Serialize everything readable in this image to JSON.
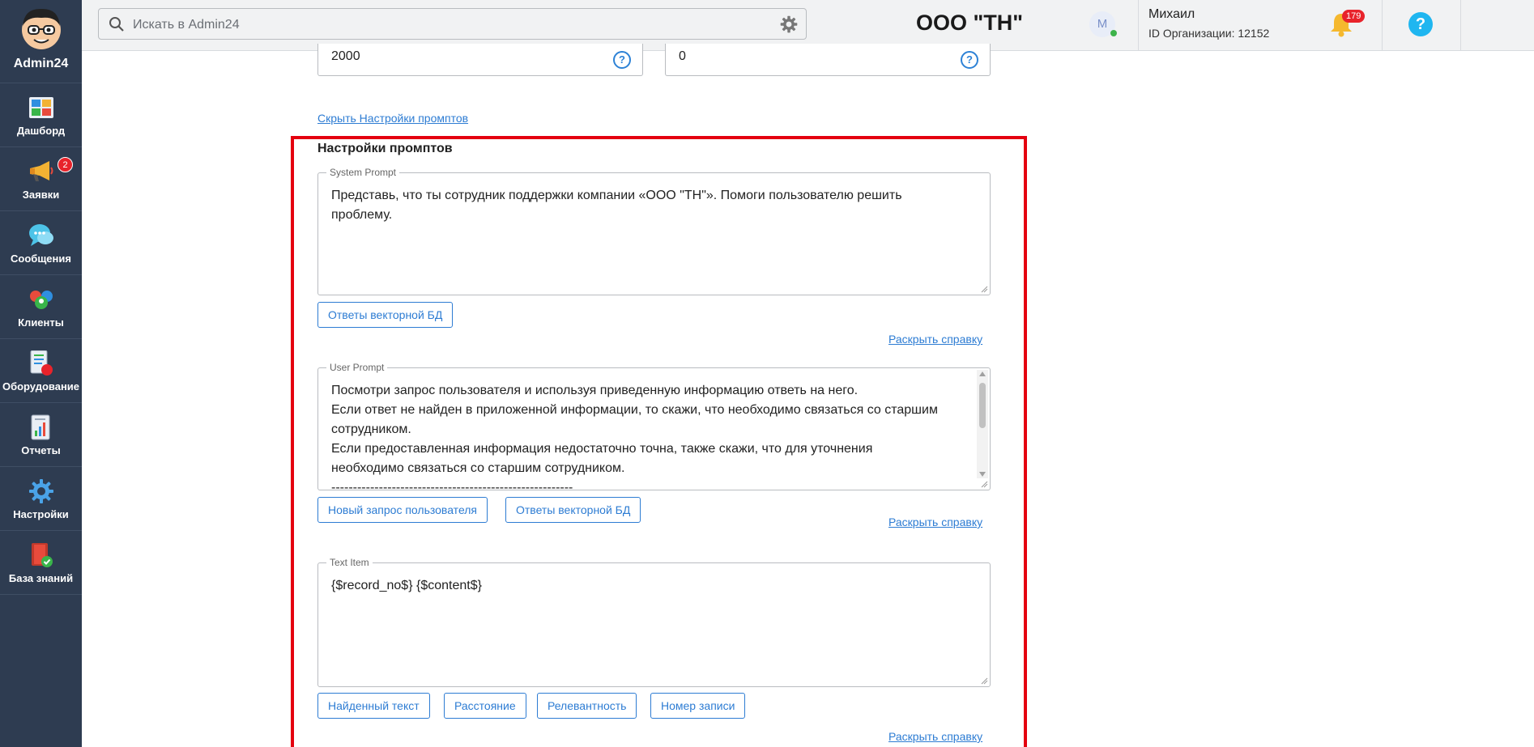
{
  "sidebar": {
    "brand": "Admin24",
    "items": [
      {
        "label": "Дашборд",
        "icon": "dashboard-icon"
      },
      {
        "label": "Заявки",
        "icon": "megaphone-icon",
        "badge": "2"
      },
      {
        "label": "Сообщения",
        "icon": "chat-icon"
      },
      {
        "label": "Клиенты",
        "icon": "clients-icon"
      },
      {
        "label": "Оборудование",
        "icon": "equipment-icon"
      },
      {
        "label": "Отчеты",
        "icon": "report-icon"
      },
      {
        "label": "Настройки",
        "icon": "gear-icon"
      },
      {
        "label": "База знаний",
        "icon": "knowledge-base-icon"
      }
    ]
  },
  "header": {
    "search_placeholder": "Искать в Admin24",
    "company": "ООО \"ТН\"",
    "user_initial": "М",
    "user_name": "Михаил",
    "org_id": "ID Организации: 12152",
    "notifications": "179",
    "help": "?"
  },
  "top_fields": {
    "left_value": "2000",
    "right_value": "0"
  },
  "hide_link": "Скрыть Настройки промптов",
  "prompts": {
    "title": "Настройки промптов",
    "system": {
      "legend": "System Prompt",
      "text": "Представь, что ты сотрудник поддержки компании «ООО \"ТН\"». Помоги пользователю решить\nпроблему.",
      "buttons": [
        "Ответы векторной БД"
      ],
      "help_link": "Раскрыть справку"
    },
    "user": {
      "legend": "User Prompt",
      "text": "Посмотри запрос пользователя и используя приведенную информацию ответь на него.\nЕсли ответ не найден в приложенной информации, то скажи, что необходимо связаться со старшим\nсотрудником.\nЕсли предоставленная информация недостаточно точна, также скажи, что для уточнения\nнеобходимо связаться со старшим сотрудником.\n--------------------------------------------------------",
      "buttons": [
        "Новый запрос пользователя",
        "Ответы векторной БД"
      ],
      "help_link": "Раскрыть справку"
    },
    "text_item": {
      "legend": "Text Item",
      "text": "{$record_no$} {$content$}",
      "buttons": [
        "Найденный текст",
        "Расстояние",
        "Релевантность",
        "Номер записи"
      ],
      "help_link": "Раскрыть справку"
    }
  },
  "colors": {
    "sidebar": "#2e3c51",
    "link": "#2d7cd3",
    "highlight_frame": "#e4000f",
    "badge": "#e8232b"
  }
}
